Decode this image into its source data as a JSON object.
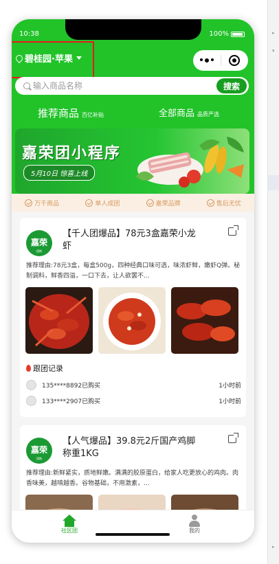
{
  "status_bar": {
    "time": "10:38",
    "battery": "100%"
  },
  "location": {
    "name": "碧桂园·苹果"
  },
  "search": {
    "placeholder": "输入商品名称",
    "button": "搜索"
  },
  "tabs": [
    {
      "label": "推荐商品",
      "sub": "百亿补贴"
    },
    {
      "label": "全部商品",
      "sub": "品质严选"
    }
  ],
  "banner": {
    "title": "嘉荣团小程序",
    "date": "5月10日 惊喜上线"
  },
  "features": [
    "万千商品",
    "单人成团",
    "嘉荣品牌",
    "售后无忧"
  ],
  "products": [
    {
      "logo_text": "嘉荣",
      "logo_sub": "团购",
      "title": "【千人团爆品】78元3盒嘉荣小龙虾",
      "reason": "推荐理由:78元3盒，每盒500g，四种经典口味可选，味浓虾鲜，嫩虾Q弹。秘制调料，鲜香四溢，一口下去，让人欲罢不...",
      "follow_title": "跟团记录",
      "records": [
        {
          "user": "135****8892已购买",
          "ago": "1小时前"
        },
        {
          "user": "133****2907已购买",
          "ago": "1小时前"
        }
      ]
    },
    {
      "logo_text": "嘉荣",
      "logo_sub": "团购",
      "title": "【人气爆品】39.8元2斤国产鸡脚称重1KG",
      "reason": "推荐理由:新鲜紧实，质地鲜嫩。满满的胶原蛋白，给家人吃更放心的鸡肉。肉香味美，越啃越香。谷物基础，不用激素，..."
    }
  ],
  "tabbar": [
    {
      "label": "社区团"
    },
    {
      "label": "我的"
    }
  ],
  "colors": {
    "brand_green": "#21c329",
    "accent_red": "#e81b1b",
    "feature_tan": "#d59a62"
  }
}
